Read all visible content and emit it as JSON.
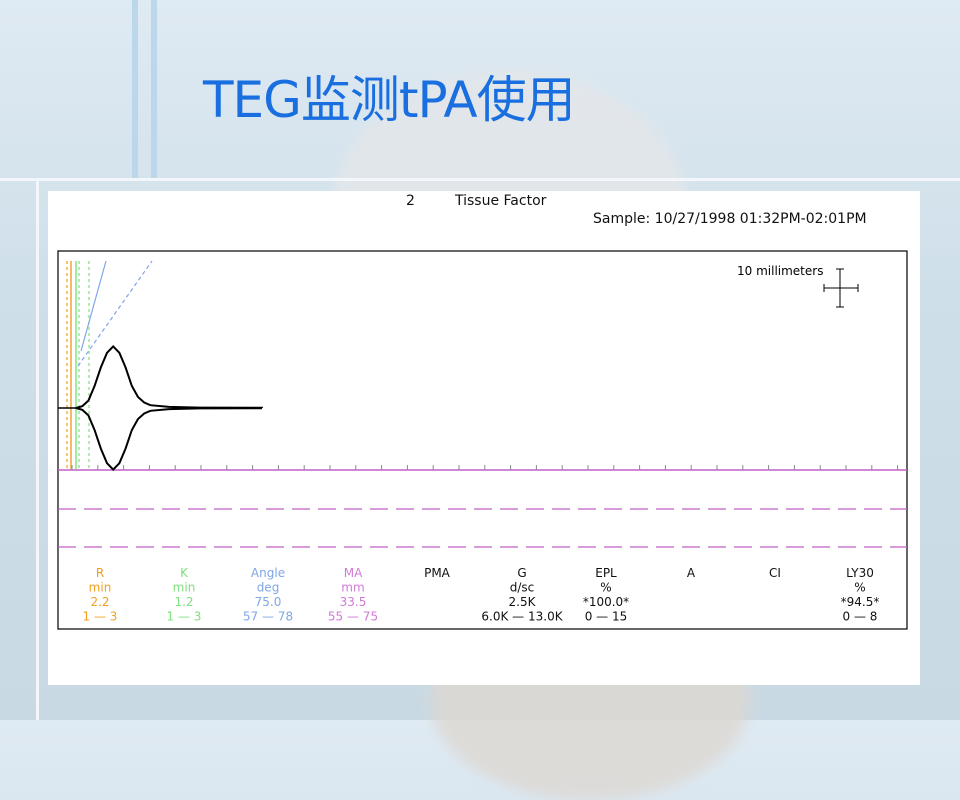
{
  "slide": {
    "title": "TEG监测tPA使用"
  },
  "report": {
    "channel": "2",
    "test_name": "Tissue Factor",
    "sample": "Sample: 10/27/1998 01:32PM-02:01PM",
    "scale_label": "10 millimeters"
  },
  "colors": {
    "title": "#1a6fe0",
    "R": "#f0a020",
    "K": "#7ee07e",
    "Angle": "#7fa6e8",
    "MA": "#d07ad6",
    "trace": "#000000",
    "baseline": "#c060c8"
  },
  "chart_data": {
    "type": "line",
    "title": "",
    "xlabel": "",
    "ylabel": "",
    "trace": {
      "x_mm": [
        0,
        2,
        4,
        6,
        8,
        10,
        12,
        14,
        16,
        18,
        20,
        22,
        24,
        30,
        40,
        60
      ],
      "amplitude_mm": [
        0,
        1,
        4,
        12,
        22,
        30,
        33.5,
        30,
        22,
        12,
        6,
        3,
        1.5,
        0.6,
        0.2,
        0.1
      ]
    },
    "parameters": [
      {
        "name": "R",
        "unit": "min",
        "value": "2.2",
        "range": "1 — 3",
        "color": "#f0a020"
      },
      {
        "name": "K",
        "unit": "min",
        "value": "1.2",
        "range": "1 — 3",
        "color": "#7ee07e"
      },
      {
        "name": "Angle",
        "unit": "deg",
        "value": "75.0",
        "range": "57 — 78",
        "color": "#7fa6e8"
      },
      {
        "name": "MA",
        "unit": "mm",
        "value": "33.5",
        "range": "55 — 75",
        "color": "#d07ad6"
      },
      {
        "name": "PMA",
        "unit": "",
        "value": "",
        "range": "",
        "color": "#111111"
      },
      {
        "name": "G",
        "unit": "d/sc",
        "value": "2.5K",
        "range": "6.0K — 13.0K",
        "color": "#111111"
      },
      {
        "name": "EPL",
        "unit": "%",
        "value": "*100.0*",
        "range": "0 — 15",
        "color": "#111111"
      },
      {
        "name": "A",
        "unit": "",
        "value": "",
        "range": "",
        "color": "#111111"
      },
      {
        "name": "CI",
        "unit": "",
        "value": "",
        "range": "",
        "color": "#111111"
      },
      {
        "name": "LY30",
        "unit": "%",
        "value": "*94.5*",
        "range": "0 — 8",
        "color": "#111111"
      }
    ]
  }
}
